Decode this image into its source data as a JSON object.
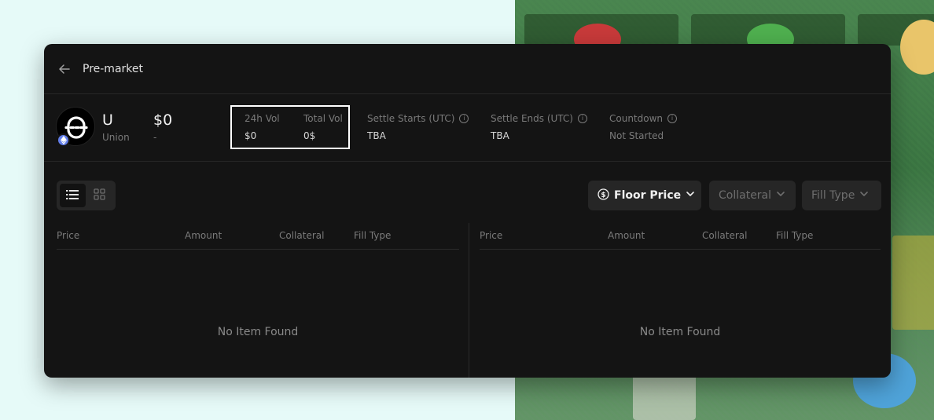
{
  "header": {
    "title": "Pre-market"
  },
  "token": {
    "symbol": "U",
    "name": "Union",
    "price": "$0",
    "price_change": "-"
  },
  "stats": {
    "vol_24h_label": "24h Vol",
    "vol_24h_value": "$0",
    "total_vol_label": "Total Vol",
    "total_vol_value": "0$",
    "settle_starts_label": "Settle Starts (UTC)",
    "settle_starts_value": "TBA",
    "settle_ends_label": "Settle Ends (UTC)",
    "settle_ends_value": "TBA",
    "countdown_label": "Countdown",
    "countdown_value": "Not Started",
    "info_glyph": "i"
  },
  "filters": {
    "floor_price": "Floor Price",
    "collateral": "Collateral",
    "fill_type": "Fill Type",
    "dollar_glyph": "$"
  },
  "tables": {
    "left": {
      "columns": [
        "Price",
        "Amount",
        "Collateral",
        "Fill Type"
      ],
      "empty_text": "No Item Found"
    },
    "right": {
      "columns": [
        "Price",
        "Amount",
        "Collateral",
        "Fill Type"
      ],
      "empty_text": "No Item Found"
    }
  },
  "colors": {
    "panel_bg": "#141414",
    "chain_badge": "#627eea",
    "highlight_border": "#ffffff"
  },
  "icons": [
    "back-arrow-icon",
    "union-logo-icon",
    "ethereum-icon",
    "info-icon",
    "list-view-icon",
    "grid-view-icon",
    "dollar-circle-icon",
    "chevron-down-icon"
  ]
}
